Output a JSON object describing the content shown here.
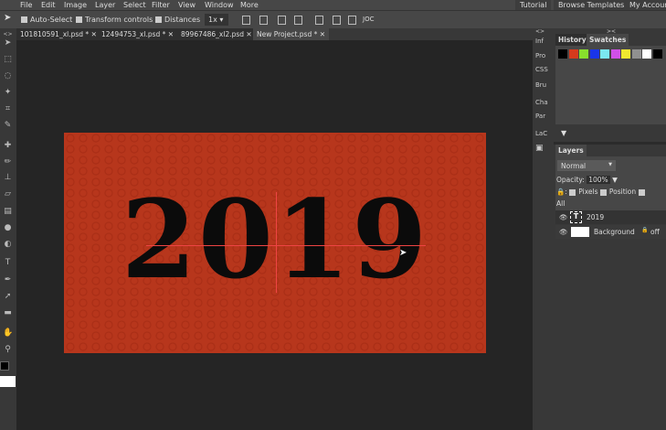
{
  "menu": [
    "File",
    "Edit",
    "Image",
    "Layer",
    "Select",
    "Filter",
    "View",
    "Window",
    "More"
  ],
  "menu_right": [
    "Tutorial",
    "Browse Templates",
    "My Account"
  ],
  "options": {
    "auto_select": "Auto-Select",
    "transform_controls": "Transform controls",
    "distances": "Distances",
    "zoom": "1x ▾",
    "extra": "JOC"
  },
  "tabs": [
    {
      "label": "101810591_xl.psd *"
    },
    {
      "label": "12494753_xl.psd *"
    },
    {
      "label": "89967486_xl2.psd"
    },
    {
      "label": "New Project.psd *"
    }
  ],
  "close": "✕",
  "canvas": {
    "text": "2019",
    "bg": "#b7361c"
  },
  "mini_panels": [
    "Inf",
    "Pro",
    "CSS",
    "Bru",
    "Cha",
    "Par",
    "LaC"
  ],
  "collapse": "<>",
  "expand": "><",
  "history_tab": "History",
  "swatches_tab": "Swatches",
  "swatches": [
    "#000000",
    "#d63a1d",
    "#88e02c",
    "#1a35e8",
    "#7be8f0",
    "#d050e8",
    "#f0e830",
    "#909090",
    "#ffffff",
    "#000000"
  ],
  "swatch_menu": "▼",
  "layers": {
    "tab": "Layers",
    "blend": "Normal",
    "opacity_label": "Opacity:",
    "opacity": "100%",
    "opacity_arrow": "▼",
    "lock": ":",
    "pixels": "Pixels",
    "position": "Position",
    "all": "All",
    "items": [
      {
        "name": "2019",
        "type": "text"
      },
      {
        "name": "Background",
        "type": "image",
        "locked": "off"
      }
    ]
  }
}
